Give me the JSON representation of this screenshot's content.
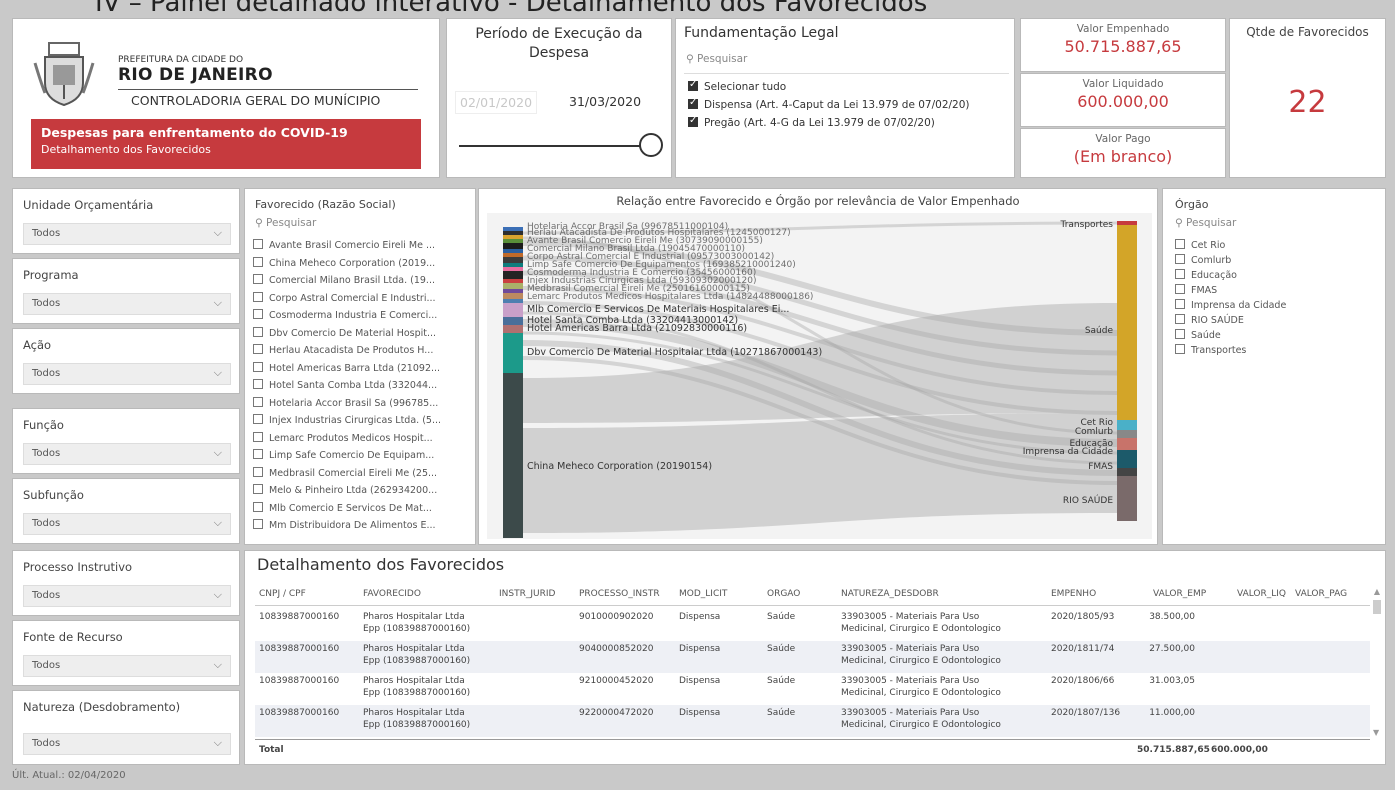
{
  "page_title": "IV – Painel detalhado interativo - Detalhamento dos Favorecidos",
  "header": {
    "org_small": "PREFEITURA DA CIDADE DO",
    "org_big": "RIO DE JANEIRO",
    "org_cgm": "CONTROLADORIA GERAL DO MUNÍCIPIO",
    "banner_title": "Despesas para enfrentamento do COVID-19",
    "banner_sub": "Detalhamento dos Favorecidos"
  },
  "period": {
    "title": "Período de Execução da Despesa",
    "start": "02/01/2020",
    "end": "31/03/2020"
  },
  "legal": {
    "title": "Fundamentação Legal",
    "search_placeholder": "Pesquisar",
    "items": [
      {
        "label": "Selecionar tudo",
        "checked": true
      },
      {
        "label": "Dispensa (Art. 4-Caput da Lei 13.979 de 07/02/20)",
        "checked": true
      },
      {
        "label": "Pregão (Art. 4-G da Lei 13.979 de 07/02/20)",
        "checked": true
      }
    ]
  },
  "kpis": {
    "empenhado_label": "Valor Empenhado",
    "empenhado_value": "50.715.887,65",
    "liquidado_label": "Valor Liquidado",
    "liquidado_value": "600.000,00",
    "pago_label": "Valor Pago",
    "pago_value": "(Em branco)",
    "favorecidos_label": "Qtde de Favorecidos",
    "favorecidos_value": "22"
  },
  "filters": [
    {
      "label": "Unidade Orçamentária",
      "value": "Todos"
    },
    {
      "label": "Programa",
      "value": "Todos"
    },
    {
      "label": "Ação",
      "value": "Todos"
    },
    {
      "label": "Função",
      "value": "Todos"
    },
    {
      "label": "Subfunção",
      "value": "Todos"
    },
    {
      "label": "Processo Instrutivo",
      "value": "Todos"
    },
    {
      "label": "Fonte de Recurso",
      "value": "Todos"
    },
    {
      "label": "Natureza (Desdobramento)",
      "value": "Todos"
    }
  ],
  "favorecido": {
    "title": "Favorecido (Razão Social)",
    "search_placeholder": "Pesquisar",
    "items": [
      "Avante Brasil Comercio Eireli Me ...",
      "China Meheco Corporation (2019...",
      "Comercial Milano Brasil Ltda. (19...",
      "Corpo Astral Comercial E Industri...",
      "Cosmoderma Industria E Comerci...",
      "Dbv Comercio De Material Hospit...",
      "Herlau Atacadista De Produtos H...",
      "Hotel Americas Barra Ltda (21092...",
      "Hotel Santa Comba Ltda (332044...",
      "Hotelaria Accor Brasil Sa (996785...",
      "Injex Industrias Cirurgicas Ltda. (5...",
      "Lemarc Produtos Medicos Hospit...",
      "Limp Safe Comercio De Equipam...",
      "Medbrasil Comercial Eireli Me (25...",
      "Melo & Pinheiro Ltda (262934200...",
      "Mlb Comercio E Servicos De Mat...",
      "Mm Distribuidora De Alimentos E..."
    ]
  },
  "sankey": {
    "title": "Relação entre Favorecido e Órgão por relevância de Valor Empenhado",
    "left_labels": [
      "Mlb Comercio E Servicos De Materiais Hospitalares Ei...",
      "Hotel Santa Comba Ltda (33204413000142)",
      "Hotel Americas Barra Ltda (21092830000116)",
      "Dbv Comercio De Material Hospitalar Ltda (10271867000143)",
      "China Meheco Corporation (20190154)"
    ],
    "right_labels": [
      "Transportes",
      "Saúde",
      "Cet Rio",
      "Comlurb",
      "Educação",
      "Imprensa da Cidade",
      "FMAS",
      "RIO SAÚDE"
    ]
  },
  "orgao": {
    "title": "Órgão",
    "search_placeholder": "Pesquisar",
    "items": [
      "Cet Rio",
      "Comlurb",
      "Educação",
      "FMAS",
      "Imprensa da Cidade",
      "RIO SAÚDE",
      "Saúde",
      "Transportes"
    ]
  },
  "table": {
    "title": "Detalhamento dos Favorecidos",
    "headers": [
      "CNPJ / CPF",
      "FAVORECIDO",
      "INSTR_JURID",
      "PROCESSO_INSTR",
      "MOD_LICIT",
      "ORGAO",
      "NATUREZA_DESDOBR",
      "EMPENHO",
      "VALOR_EMP",
      "VALOR_LIQ",
      "VALOR_PAG"
    ],
    "rows": [
      {
        "cnpj": "10839887000160",
        "fav1": "Pharos Hospitalar Ltda",
        "fav2": "Epp (10839887000160)",
        "proc": "9010000902020",
        "mod": "Dispensa",
        "org": "Saúde",
        "nat1": "33903005 - Materiais Para Uso",
        "nat2": "Medicinal, Cirurgico E Odontologico",
        "emp": "2020/1805/93",
        "valor": "38.500,00"
      },
      {
        "cnpj": "10839887000160",
        "fav1": "Pharos Hospitalar Ltda",
        "fav2": "Epp (10839887000160)",
        "proc": "9040000852020",
        "mod": "Dispensa",
        "org": "Saúde",
        "nat1": "33903005 - Materiais Para Uso",
        "nat2": "Medicinal, Cirurgico E Odontologico",
        "emp": "2020/1811/74",
        "valor": "27.500,00"
      },
      {
        "cnpj": "10839887000160",
        "fav1": "Pharos Hospitalar Ltda",
        "fav2": "Epp (10839887000160)",
        "proc": "9210000452020",
        "mod": "Dispensa",
        "org": "Saúde",
        "nat1": "33903005 - Materiais Para Uso",
        "nat2": "Medicinal, Cirurgico E Odontologico",
        "emp": "2020/1806/66",
        "valor": "31.003,05"
      },
      {
        "cnpj": "10839887000160",
        "fav1": "Pharos Hospitalar Ltda",
        "fav2": "Epp (10839887000160)",
        "proc": "9220000472020",
        "mod": "Dispensa",
        "org": "Saúde",
        "nat1": "33903005 - Materiais Para Uso",
        "nat2": "Medicinal, Cirurgico E Odontologico",
        "emp": "2020/1807/136",
        "valor": "11.000,00"
      }
    ],
    "total_label": "Total",
    "total_emp": "50.715.887,65",
    "total_liq": "600.000,00"
  },
  "footer": "Últ. Atual.: 02/04/2020",
  "colors": {
    "accent": "#c63a3e"
  }
}
